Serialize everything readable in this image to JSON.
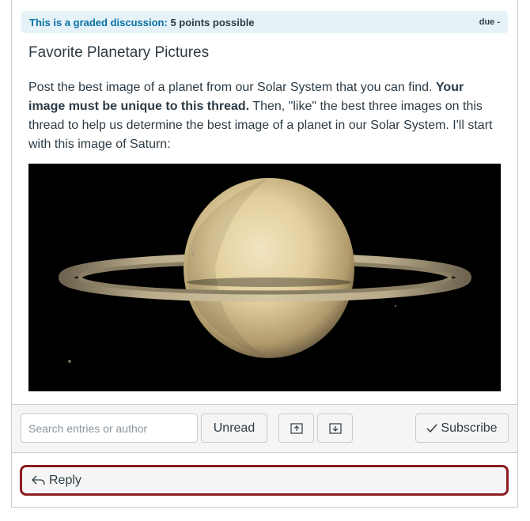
{
  "graded": {
    "prefix": "This is a graded discussion:",
    "points": "5 points possible",
    "due": "due -"
  },
  "topic": {
    "title": "Favorite Planetary Pictures",
    "body_part1": "Post the best image of a planet from our Solar System that you can find. ",
    "body_bold": "Your image must be unique to this thread.",
    "body_part2": " Then, \"like\" the best three images on this thread to help us determine the best image of a planet in our Solar System. I'll start with this image of Saturn:"
  },
  "toolbar": {
    "search_placeholder": "Search entries or author",
    "unread_label": "Unread",
    "subscribe_label": "Subscribe"
  },
  "reply": {
    "label": "Reply"
  },
  "colors": {
    "accent": "#0770a3",
    "highlight_border": "#8c1c1f"
  }
}
